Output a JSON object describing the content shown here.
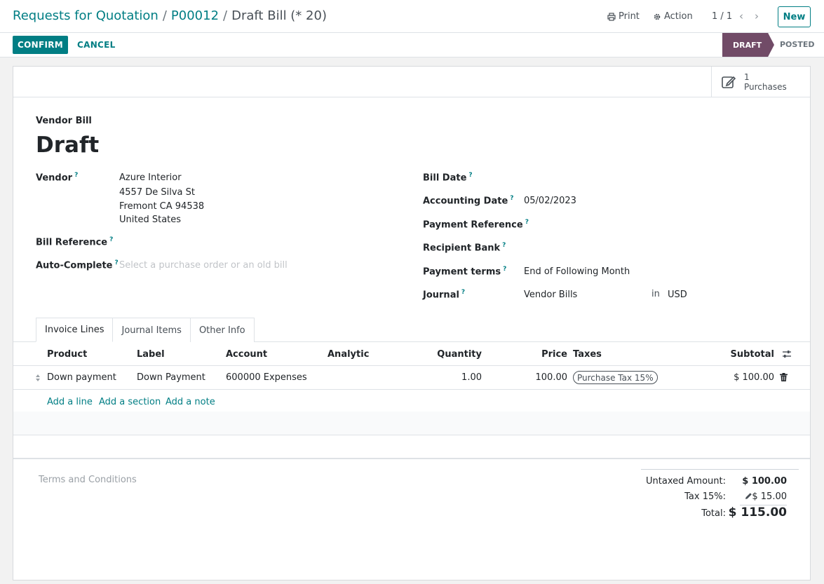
{
  "breadcrumb": {
    "root": "Requests for Quotation",
    "parent": "P00012",
    "current": "Draft Bill (* 20)"
  },
  "header": {
    "print_label": "Print",
    "action_label": "Action",
    "pager": "1 / 1",
    "new_label": "New"
  },
  "control": {
    "confirm_label": "CONFIRM",
    "cancel_label": "CANCEL",
    "status_draft": "DRAFT",
    "status_posted": "POSTED"
  },
  "smart_button": {
    "count": "1",
    "label": "Purchases"
  },
  "form": {
    "type_label": "Vendor Bill",
    "name": "Draft",
    "vendor_label": "Vendor",
    "vendor_name": "Azure Interior",
    "vendor_street": "4557 De Silva St",
    "vendor_city": "Fremont CA 94538",
    "vendor_country": "United States",
    "bill_reference_label": "Bill Reference",
    "autocomplete_label": "Auto-Complete",
    "autocomplete_placeholder": "Select a purchase order or an old bill",
    "bill_date_label": "Bill Date",
    "accounting_date_label": "Accounting Date",
    "accounting_date": "05/02/2023",
    "payment_reference_label": "Payment Reference",
    "recipient_bank_label": "Recipient Bank",
    "payment_terms_label": "Payment terms",
    "payment_terms": "End of Following Month",
    "journal_label": "Journal",
    "journal": "Vendor Bills",
    "in_label": "in",
    "currency": "USD",
    "help_mark": "?"
  },
  "tabs": [
    "Invoice Lines",
    "Journal Items",
    "Other Info"
  ],
  "lines": {
    "columns": {
      "product": "Product",
      "label": "Label",
      "account": "Account",
      "analytic": "Analytic",
      "quantity": "Quantity",
      "price": "Price",
      "taxes": "Taxes",
      "subtotal": "Subtotal"
    },
    "rows": [
      {
        "product": "Down payment",
        "label": "Down Payment",
        "account": "600000 Expenses",
        "quantity": "1.00",
        "price": "100.00",
        "tax": "Purchase Tax 15%",
        "subtotal": "$ 100.00"
      }
    ],
    "add_line": "Add a line",
    "add_section": "Add a section",
    "add_note": "Add a note"
  },
  "terms_placeholder": "Terms and Conditions",
  "totals": {
    "untaxed_label": "Untaxed Amount:",
    "untaxed_value": "$ 100.00",
    "tax_label": "Tax 15%:",
    "tax_value": "$ 15.00",
    "total_label": "Total:",
    "total_value": "$ 115.00"
  },
  "colors": {
    "accent": "#017e84",
    "status": "#714b67"
  },
  "icons": [
    "print-icon",
    "gear-icon",
    "chevron-left-icon",
    "chevron-right-icon",
    "edit-icon",
    "sort-handle-icon",
    "column-settings-icon",
    "trash-icon",
    "pencil-icon"
  ]
}
